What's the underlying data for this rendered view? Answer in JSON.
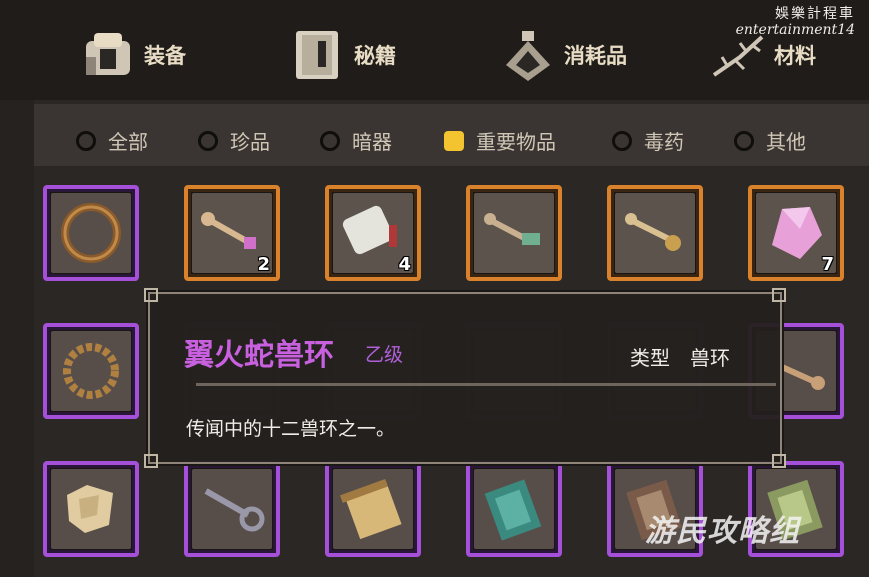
{
  "watermark_top": {
    "cn": "娛樂計程車",
    "en": "entertainment14"
  },
  "watermark_bottom": "游民攻略组",
  "categories": [
    {
      "label": "装备",
      "icon": "armor-icon"
    },
    {
      "label": "秘籍",
      "icon": "book-icon"
    },
    {
      "label": "消耗品",
      "icon": "potion-icon"
    },
    {
      "label": "材料",
      "icon": "herb-icon"
    }
  ],
  "filters": [
    {
      "label": "全部",
      "selected": false
    },
    {
      "label": "珍品",
      "selected": false
    },
    {
      "label": "暗器",
      "selected": false
    },
    {
      "label": "重要物品",
      "selected": true
    },
    {
      "label": "毒药",
      "selected": false
    },
    {
      "label": "其他",
      "selected": false
    }
  ],
  "inventory": {
    "row1": [
      {
        "icon": "bronze-ring-icon",
        "rarity": "purple",
        "count": ""
      },
      {
        "icon": "pink-gem-key-icon",
        "rarity": "orange",
        "count": "2"
      },
      {
        "icon": "jade-tablet-icon",
        "rarity": "orange",
        "count": "4"
      },
      {
        "icon": "green-key-icon",
        "rarity": "orange",
        "count": ""
      },
      {
        "icon": "gold-key-icon",
        "rarity": "orange",
        "count": ""
      },
      {
        "icon": "pink-crystal-icon",
        "rarity": "orange",
        "count": "7"
      }
    ],
    "row2": [
      {
        "icon": "serpent-ring-icon",
        "rarity": "purple",
        "count": ""
      },
      {
        "icon": "dim-ring-icon",
        "rarity": "purple",
        "count": ""
      },
      {
        "icon": "dim-ring-icon",
        "rarity": "purple",
        "count": ""
      },
      {
        "icon": "dim-ring-icon",
        "rarity": "purple",
        "count": ""
      },
      {
        "icon": "dim-ring-icon",
        "rarity": "purple",
        "count": ""
      },
      {
        "icon": "bronze-key-icon",
        "rarity": "purple",
        "count": ""
      }
    ],
    "row3": [
      {
        "icon": "map-scrap-icon",
        "rarity": "purple",
        "count": ""
      },
      {
        "icon": "iron-key-icon",
        "rarity": "purple",
        "count": ""
      },
      {
        "icon": "scroll-icon",
        "rarity": "purple",
        "count": ""
      },
      {
        "icon": "teal-manual-icon",
        "rarity": "purple",
        "count": ""
      },
      {
        "icon": "brown-manual-icon",
        "rarity": "purple",
        "count": ""
      },
      {
        "icon": "green-manual-icon",
        "rarity": "purple",
        "count": ""
      }
    ]
  },
  "tooltip": {
    "name": "翼火蛇兽环",
    "grade": "乙级",
    "type_label": "类型",
    "type_value": "兽环",
    "description": "传闻中的十二兽环之一。"
  },
  "colors": {
    "orange_frame": "#d9822b",
    "purple_frame": "#a450d8",
    "selected_radio": "#f4c430",
    "item_name": "#c860e0"
  }
}
